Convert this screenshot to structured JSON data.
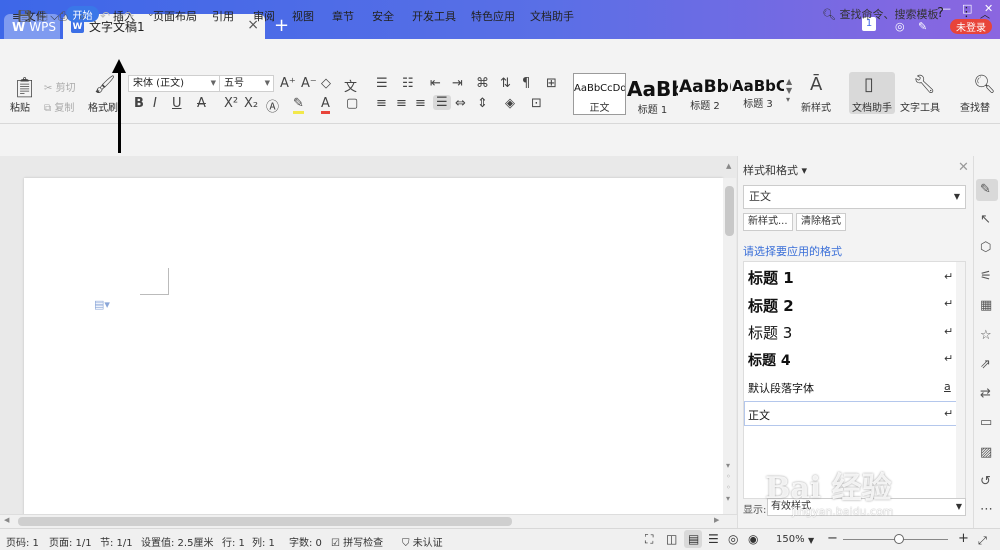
{
  "titlebar": {
    "wps_tab": "WPS",
    "doc_tab": "文字文稿1",
    "add_tab": "+",
    "login": "未登录",
    "badge": "1"
  },
  "menu": {
    "file": "≡ 文件 ⌵",
    "items": [
      "开始",
      "插入",
      "页面布局",
      "引用",
      "审阅",
      "视图",
      "章节",
      "安全",
      "开发工具",
      "特色应用",
      "文档助手"
    ],
    "search": "查找命令、搜索模板"
  },
  "ribbon": {
    "paste": "粘贴",
    "cut": "剪切",
    "copy": "复制",
    "format_painter": "格式刷",
    "font_name": "宋体 (正文)",
    "font_size": "五号",
    "styles": [
      {
        "preview": "AaBbCcDd",
        "name": "正文"
      },
      {
        "preview": "AaBb",
        "name": "标题 1"
      },
      {
        "preview": "AaBb(",
        "name": "标题 2"
      },
      {
        "preview": "AaBbC(",
        "name": "标题 3"
      }
    ],
    "new_style": "新样式",
    "doc_helper": "文档助手",
    "text_tools": "文字工具",
    "find_replace": "查找替"
  },
  "pane": {
    "title": "样式和格式 ▾",
    "current": "正文",
    "new_style_btn": "新样式...",
    "clear_btn": "清除格式",
    "hint": "请选择要应用的格式",
    "items": [
      {
        "label": "标题  1",
        "mark": "↵"
      },
      {
        "label": "标题  2",
        "mark": "↵"
      },
      {
        "label": "标题  3",
        "mark": "↵"
      },
      {
        "label": "标题  4",
        "mark": "↵"
      },
      {
        "label": "默认段落字体",
        "mark": "a"
      },
      {
        "label": "正文",
        "mark": "↵"
      }
    ],
    "show_label": "显示:",
    "show_value": "有效样式"
  },
  "status": {
    "page_num": "页码: 1",
    "pages": "页面: 1/1",
    "section": "节: 1/1",
    "setting": "设置值: 2.5厘米",
    "row": "行: 1",
    "col": "列: 1",
    "words": "字数: 0",
    "spell": "拼写检查",
    "cert": "未认证",
    "zoom": "150%"
  },
  "watermark": {
    "main": "Bai 经验",
    "sub": "jingyan.baidu.com"
  }
}
